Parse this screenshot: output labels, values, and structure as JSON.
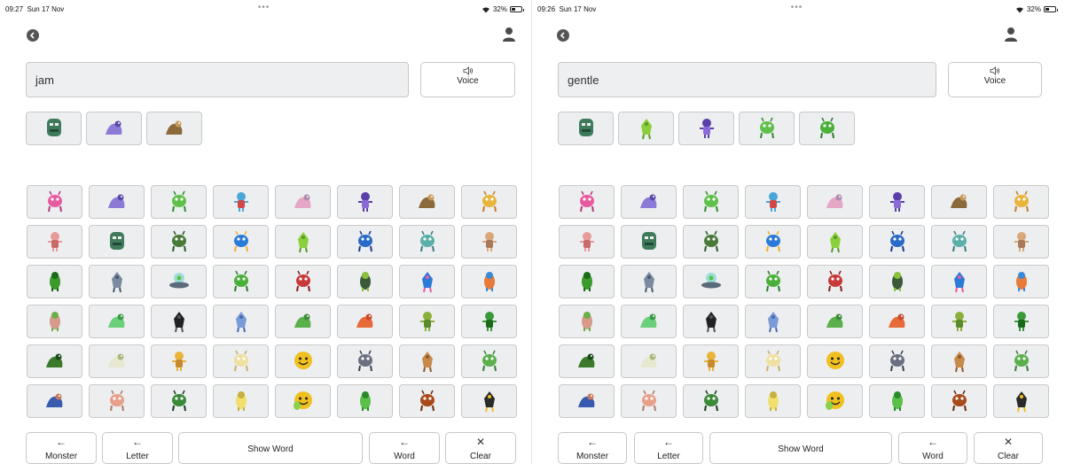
{
  "screens": [
    {
      "status": {
        "time": "09:27",
        "date": "Sun 17 Nov",
        "battery": "32%"
      },
      "current_word": "jam",
      "voice_label": "Voice",
      "word_monsters": [
        "ogre-green",
        "purple-blob",
        "bird-brown"
      ]
    },
    {
      "status": {
        "time": "09:26",
        "date": "Sun 17 Nov",
        "battery": "32%"
      },
      "current_word": "gentle",
      "voice_label": "Voice",
      "word_monsters": [
        "ogre-green",
        "green-caterpillar",
        "purple-grape",
        "green-antenna",
        "green-lizard"
      ]
    }
  ],
  "controls": {
    "monster": "Monster",
    "letter": "Letter",
    "show_word": "Show Word",
    "word": "Word",
    "clear": "Clear"
  },
  "icons": {
    "back": "back-icon",
    "user": "user-icon",
    "speaker": "speaker-icon",
    "wifi": "wifi-icon",
    "battery": "battery-icon"
  },
  "monster_grid": [
    [
      "pink-dino",
      "purple-blob",
      "green-antenna",
      "blue-robot",
      "pink-fluffy",
      "purple-grape",
      "bird-brown",
      "yellow-bunny"
    ],
    [
      "pink-pig",
      "ogre-green",
      "green-croc",
      "blue-bird",
      "green-caterpillar",
      "blue-llama",
      "teal-jellyfish",
      "tan-rabbit"
    ],
    [
      "green-frog",
      "grey-robot",
      "ufo-alien",
      "green-lizard",
      "red-devil",
      "green-bug",
      "blue-bird-pink",
      "orange-fox"
    ],
    [
      "pink-pair",
      "green-sprite",
      "black-ball",
      "blue-alien",
      "green-blob",
      "red-dragon",
      "green-leaf",
      "green-runner"
    ],
    [
      "green-hulk",
      "white-bird",
      "yellow-dog",
      "cream-chick",
      "smiley-face",
      "grey-robot-2",
      "orange-robot",
      "green-stick"
    ],
    [
      "blue-pair",
      "pink-pair-small",
      "green-bat",
      "yellow-stick",
      "green-smiley",
      "green-trio",
      "brown-monster",
      "penguin"
    ]
  ],
  "colors": {
    "tile_bg": "#eceef0",
    "tile_border": "#c9c9c9",
    "field_bg": "#eeeff1"
  }
}
